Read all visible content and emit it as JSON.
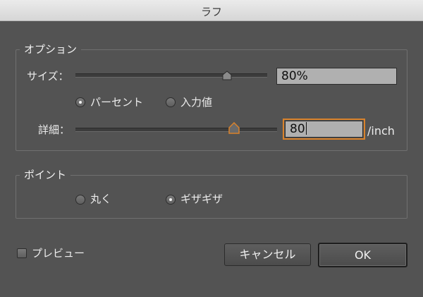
{
  "window": {
    "title": "ラフ"
  },
  "options": {
    "group_label": "オプション",
    "size": {
      "label": "サイズ：",
      "value": "80%",
      "slider_value": 0.8
    },
    "mode": {
      "options": [
        "パーセント",
        "入力値"
      ],
      "selected": "パーセント"
    },
    "detail": {
      "label": "詳細：",
      "value": "80",
      "unit": "/inch",
      "slider_value": 0.8
    }
  },
  "point": {
    "group_label": "ポイント",
    "options": [
      "丸く",
      "ギザギザ"
    ],
    "selected": "ギザギザ"
  },
  "preview": {
    "label": "プレビュー",
    "checked": false
  },
  "buttons": {
    "cancel": "キャンセル",
    "ok": "OK"
  },
  "colors": {
    "background": "#535353",
    "focus": "#d9822b"
  }
}
